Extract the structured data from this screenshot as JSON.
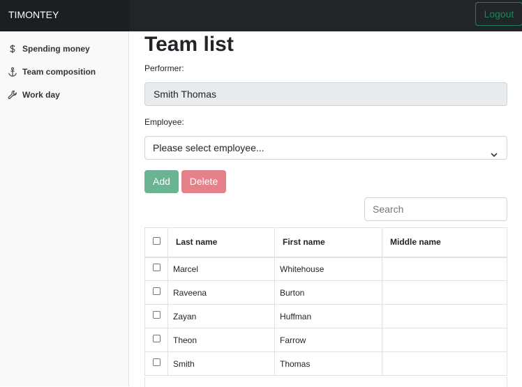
{
  "header": {
    "brand": "TIMONTEY",
    "logout_label": "Logout"
  },
  "sidebar": {
    "items": [
      {
        "label": "Spending money",
        "icon": "dollar-icon"
      },
      {
        "label": "Team composition",
        "icon": "anchor-icon"
      },
      {
        "label": "Work day",
        "icon": "wrench-icon"
      }
    ]
  },
  "main": {
    "title": "Team list",
    "performer_label": "Performer:",
    "performer_value": "Smith Thomas",
    "employee_label": "Employee:",
    "employee_select": "Please select employee...",
    "add_label": "Add",
    "delete_label": "Delete",
    "search_placeholder": "Search"
  },
  "table": {
    "headers": [
      "Last name",
      "First name",
      "Middle name"
    ],
    "rows": [
      {
        "last": "Marcel",
        "first": "Whitehouse",
        "middle": ""
      },
      {
        "last": "Raveena",
        "first": "Burton",
        "middle": ""
      },
      {
        "last": "Zayan",
        "first": "Huffman",
        "middle": ""
      },
      {
        "last": "Theon",
        "first": "Farrow",
        "middle": ""
      },
      {
        "last": "Smith",
        "first": "Thomas",
        "middle": ""
      }
    ]
  },
  "colors": {
    "topbar": "#212529",
    "accent_green": "#198754",
    "add_button": "#6ab393",
    "delete_button": "#e58189"
  }
}
